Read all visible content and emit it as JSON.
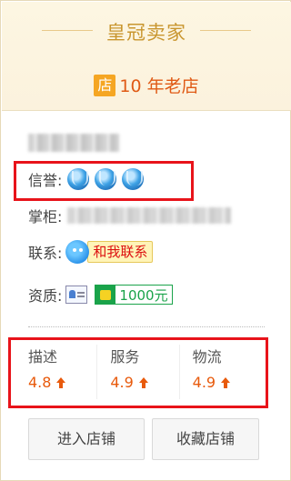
{
  "header": {
    "title": "皇冠卖家",
    "shop_badge": "店",
    "shop_age": "10 年老店"
  },
  "info": {
    "credit_label": "信誉:",
    "owner_label": "掌柜:",
    "contact_label": "联系:",
    "contact_button": "和我联系",
    "qualification_label": "资质:",
    "deposit": "1000元"
  },
  "ratings": [
    {
      "label": "描述",
      "score": "4.8"
    },
    {
      "label": "服务",
      "score": "4.9"
    },
    {
      "label": "物流",
      "score": "4.9"
    }
  ],
  "actions": {
    "enter_shop": "进入店铺",
    "favorite_shop": "收藏店铺"
  },
  "colors": {
    "title": "#c9962f",
    "accent": "#e85a0c",
    "highlight": "#e8131a",
    "deposit": "#1aa34a"
  },
  "icons": [
    "crown-icon",
    "wangwang-icon",
    "id-card-icon",
    "deposit-icon",
    "arrow-up-icon"
  ]
}
